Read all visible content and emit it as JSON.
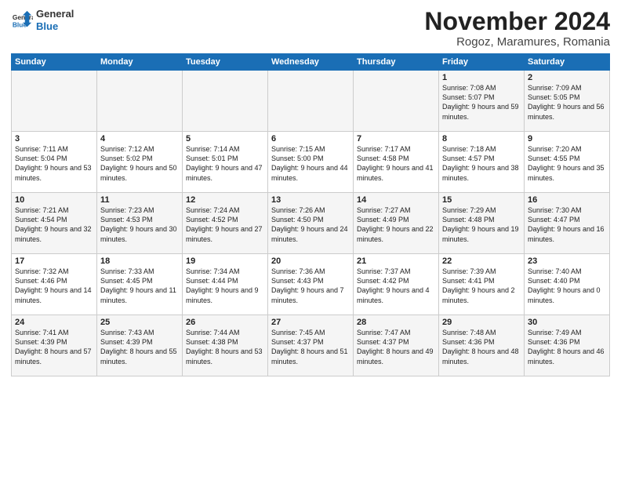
{
  "logo": {
    "text_general": "General",
    "text_blue": "Blue"
  },
  "header": {
    "title": "November 2024",
    "subtitle": "Rogoz, Maramures, Romania"
  },
  "columns": [
    "Sunday",
    "Monday",
    "Tuesday",
    "Wednesday",
    "Thursday",
    "Friday",
    "Saturday"
  ],
  "weeks": [
    [
      {
        "day": "",
        "text": ""
      },
      {
        "day": "",
        "text": ""
      },
      {
        "day": "",
        "text": ""
      },
      {
        "day": "",
        "text": ""
      },
      {
        "day": "",
        "text": ""
      },
      {
        "day": "1",
        "text": "Sunrise: 7:08 AM\nSunset: 5:07 PM\nDaylight: 9 hours and 59 minutes."
      },
      {
        "day": "2",
        "text": "Sunrise: 7:09 AM\nSunset: 5:05 PM\nDaylight: 9 hours and 56 minutes."
      }
    ],
    [
      {
        "day": "3",
        "text": "Sunrise: 7:11 AM\nSunset: 5:04 PM\nDaylight: 9 hours and 53 minutes."
      },
      {
        "day": "4",
        "text": "Sunrise: 7:12 AM\nSunset: 5:02 PM\nDaylight: 9 hours and 50 minutes."
      },
      {
        "day": "5",
        "text": "Sunrise: 7:14 AM\nSunset: 5:01 PM\nDaylight: 9 hours and 47 minutes."
      },
      {
        "day": "6",
        "text": "Sunrise: 7:15 AM\nSunset: 5:00 PM\nDaylight: 9 hours and 44 minutes."
      },
      {
        "day": "7",
        "text": "Sunrise: 7:17 AM\nSunset: 4:58 PM\nDaylight: 9 hours and 41 minutes."
      },
      {
        "day": "8",
        "text": "Sunrise: 7:18 AM\nSunset: 4:57 PM\nDaylight: 9 hours and 38 minutes."
      },
      {
        "day": "9",
        "text": "Sunrise: 7:20 AM\nSunset: 4:55 PM\nDaylight: 9 hours and 35 minutes."
      }
    ],
    [
      {
        "day": "10",
        "text": "Sunrise: 7:21 AM\nSunset: 4:54 PM\nDaylight: 9 hours and 32 minutes."
      },
      {
        "day": "11",
        "text": "Sunrise: 7:23 AM\nSunset: 4:53 PM\nDaylight: 9 hours and 30 minutes."
      },
      {
        "day": "12",
        "text": "Sunrise: 7:24 AM\nSunset: 4:52 PM\nDaylight: 9 hours and 27 minutes."
      },
      {
        "day": "13",
        "text": "Sunrise: 7:26 AM\nSunset: 4:50 PM\nDaylight: 9 hours and 24 minutes."
      },
      {
        "day": "14",
        "text": "Sunrise: 7:27 AM\nSunset: 4:49 PM\nDaylight: 9 hours and 22 minutes."
      },
      {
        "day": "15",
        "text": "Sunrise: 7:29 AM\nSunset: 4:48 PM\nDaylight: 9 hours and 19 minutes."
      },
      {
        "day": "16",
        "text": "Sunrise: 7:30 AM\nSunset: 4:47 PM\nDaylight: 9 hours and 16 minutes."
      }
    ],
    [
      {
        "day": "17",
        "text": "Sunrise: 7:32 AM\nSunset: 4:46 PM\nDaylight: 9 hours and 14 minutes."
      },
      {
        "day": "18",
        "text": "Sunrise: 7:33 AM\nSunset: 4:45 PM\nDaylight: 9 hours and 11 minutes."
      },
      {
        "day": "19",
        "text": "Sunrise: 7:34 AM\nSunset: 4:44 PM\nDaylight: 9 hours and 9 minutes."
      },
      {
        "day": "20",
        "text": "Sunrise: 7:36 AM\nSunset: 4:43 PM\nDaylight: 9 hours and 7 minutes."
      },
      {
        "day": "21",
        "text": "Sunrise: 7:37 AM\nSunset: 4:42 PM\nDaylight: 9 hours and 4 minutes."
      },
      {
        "day": "22",
        "text": "Sunrise: 7:39 AM\nSunset: 4:41 PM\nDaylight: 9 hours and 2 minutes."
      },
      {
        "day": "23",
        "text": "Sunrise: 7:40 AM\nSunset: 4:40 PM\nDaylight: 9 hours and 0 minutes."
      }
    ],
    [
      {
        "day": "24",
        "text": "Sunrise: 7:41 AM\nSunset: 4:39 PM\nDaylight: 8 hours and 57 minutes."
      },
      {
        "day": "25",
        "text": "Sunrise: 7:43 AM\nSunset: 4:39 PM\nDaylight: 8 hours and 55 minutes."
      },
      {
        "day": "26",
        "text": "Sunrise: 7:44 AM\nSunset: 4:38 PM\nDaylight: 8 hours and 53 minutes."
      },
      {
        "day": "27",
        "text": "Sunrise: 7:45 AM\nSunset: 4:37 PM\nDaylight: 8 hours and 51 minutes."
      },
      {
        "day": "28",
        "text": "Sunrise: 7:47 AM\nSunset: 4:37 PM\nDaylight: 8 hours and 49 minutes."
      },
      {
        "day": "29",
        "text": "Sunrise: 7:48 AM\nSunset: 4:36 PM\nDaylight: 8 hours and 48 minutes."
      },
      {
        "day": "30",
        "text": "Sunrise: 7:49 AM\nSunset: 4:36 PM\nDaylight: 8 hours and 46 minutes."
      }
    ]
  ]
}
